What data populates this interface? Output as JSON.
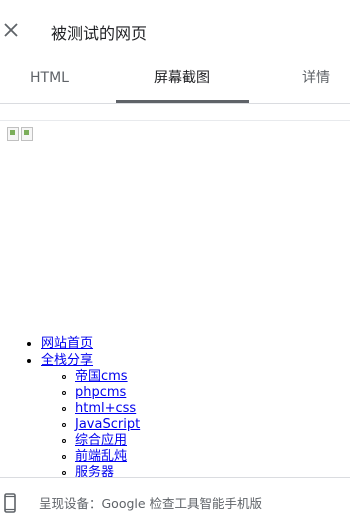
{
  "header": {
    "close_icon": "close-icon",
    "title": "被测试的网页"
  },
  "tabs": [
    {
      "label": "HTML",
      "active": false
    },
    {
      "label": "屏幕截图",
      "active": true
    },
    {
      "label": "详情",
      "active": false
    }
  ],
  "screenshot": {
    "images": [
      "broken-image-icon",
      "broken-image-icon"
    ],
    "nav": [
      {
        "label": "网站首页"
      },
      {
        "label": "全栈分享",
        "children": [
          "帝国cms",
          "phpcms",
          "html+css",
          "JavaScript",
          "综合应用",
          "前端乱炖",
          "服务器"
        ]
      }
    ]
  },
  "footer": {
    "device_icon": "smartphone-icon",
    "text": "呈现设备：Google 检查工具智能手机版"
  },
  "colors": {
    "link": "#0000ee",
    "tab_indicator": "#5f6368",
    "muted_text": "#5f6368"
  }
}
